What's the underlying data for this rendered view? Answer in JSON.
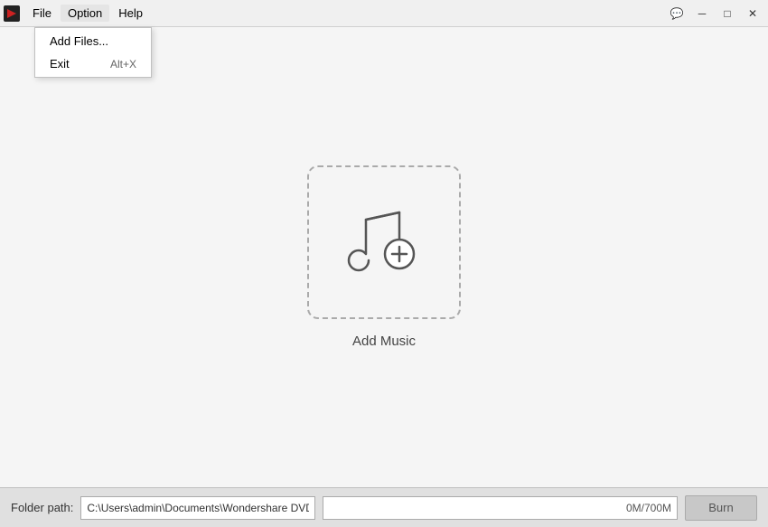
{
  "titlebar": {
    "menu": {
      "file": "File",
      "option": "Option",
      "help": "Help"
    },
    "controls": {
      "chat": "💬",
      "minimize": "─",
      "maximize": "□",
      "close": "✕"
    }
  },
  "dropdown": {
    "items": [
      {
        "label": "Add Files...",
        "shortcut": ""
      },
      {
        "label": "Exit",
        "shortcut": "Alt+X"
      }
    ]
  },
  "main": {
    "add_music_label": "Add Music"
  },
  "statusbar": {
    "folder_label": "Folder path:",
    "folder_path": "C:\\Users\\admin\\Documents\\Wondershare DVD Creat...",
    "storage": "0M/700M",
    "burn_label": "Burn"
  }
}
